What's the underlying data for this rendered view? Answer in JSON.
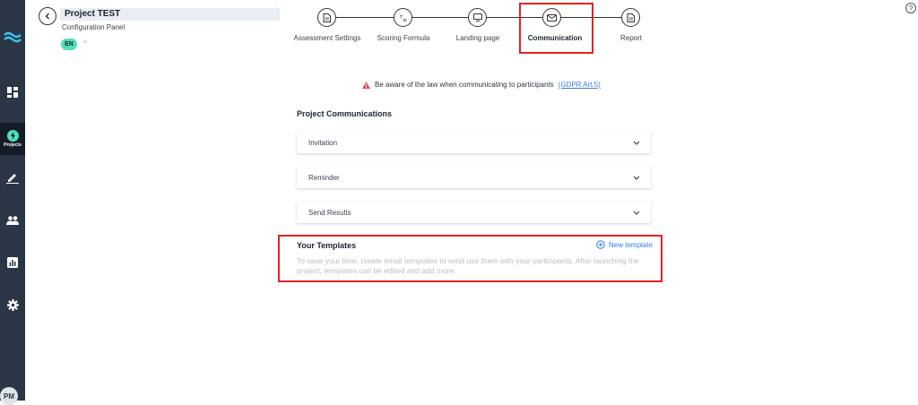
{
  "sidebar": {
    "logo": "brand-logo",
    "items": [
      {
        "name": "dashboard",
        "icon": "dashboard-icon",
        "label": ""
      },
      {
        "name": "projects",
        "icon": "bolt-icon",
        "label": "Projects",
        "active": true
      },
      {
        "name": "edit",
        "icon": "pen-icon",
        "label": ""
      },
      {
        "name": "people",
        "icon": "people-icon",
        "label": ""
      },
      {
        "name": "reports",
        "icon": "bar-chart-icon",
        "label": ""
      },
      {
        "name": "settings",
        "icon": "gear-icon",
        "label": ""
      }
    ],
    "avatar": "PM"
  },
  "header": {
    "project_title": "Project TEST",
    "subtitle": "Configuration Panel",
    "language": "EN",
    "add_language": "+",
    "help": "?"
  },
  "stepper": {
    "steps": [
      {
        "label": "Assessment Settings",
        "icon": "document-icon"
      },
      {
        "label": "Scoring Formula",
        "icon": "formula-icon"
      },
      {
        "label": "Landing page",
        "icon": "monitor-icon"
      },
      {
        "label": "Communication",
        "icon": "mail-icon",
        "active": true
      },
      {
        "label": "Report",
        "icon": "report-icon"
      }
    ]
  },
  "warning": {
    "text": "Be aware of the law when communicating to participants",
    "link": "(GDPR Art.5)",
    "icon": "warning-icon"
  },
  "communications": {
    "title": "Project Communications",
    "items": [
      "Invitation",
      "Reminder",
      "Send Results"
    ]
  },
  "templates": {
    "title": "Your Templates",
    "new_label": "New template",
    "description": "To save your time, create email templates to send use them with your participants. After launching the project, templates can be edited and add more."
  },
  "colors": {
    "sidebar_bg": "#2a3545",
    "accent_blue": "#2f7cf6",
    "language_badge": "#4fe0b6",
    "highlight_red": "#e02424",
    "warning_red": "#e5484d"
  }
}
